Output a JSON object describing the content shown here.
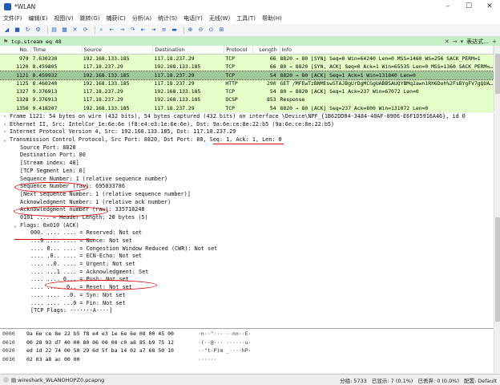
{
  "window": {
    "title": "*WLAN"
  },
  "menu": [
    "文件(F)",
    "编辑(E)",
    "视图(V)",
    "跳转(G)",
    "捕获(C)",
    "分析(A)",
    "统计(S)",
    "电话(Y)",
    "无线(W)",
    "工具(T)",
    "帮助(H)"
  ],
  "filter": {
    "value": "tcp.stream eq 48",
    "expression_label": "表达式…",
    "plus": "+"
  },
  "packet_list": {
    "columns": [
      "No.",
      "Time",
      "Source",
      "Destination",
      "Protocol",
      "Length",
      "Info"
    ],
    "rows": [
      {
        "no": "979",
        "time": "7.630230",
        "src": "192.168.133.185",
        "dst": "117.18.237.29",
        "proto": "TCP",
        "len": "66",
        "info": "8820 → 80 [SYN] Seq=0 Win=64240 Len=0 MSS=1460 WS=256 SACK_PERM=1"
      },
      {
        "no": "1120",
        "time": "8.459805",
        "src": "117.18.237.29",
        "dst": "192.168.133.185",
        "proto": "TCP",
        "len": "66",
        "info": "80 → 8820 [SYN, ACK] Seq=0 Ack=1 Win=65535 Len=0 MSS=1360 SACK_PERM=…"
      },
      {
        "no": "1121",
        "time": "8.459932",
        "src": "192.168.133.185",
        "dst": "117.18.237.29",
        "proto": "TCP",
        "len": "54",
        "info": "8820 → 80 [ACK] Seq=1 Ack=1 Win=131840 Len=0"
      },
      {
        "no": "1125",
        "time": "8.460240",
        "src": "192.168.133.185",
        "dst": "117.18.237.29",
        "proto": "HTTP",
        "len": "290",
        "info": "GET /MFEwTzBNMEswSTAJBgUrDgMCGgUABBSAUQYBMq2awn1Rh6Doh%2FsBYgFV7gQUA…"
      },
      {
        "no": "1327",
        "time": "9.376913",
        "src": "117.18.237.29",
        "dst": "192.168.133.185",
        "proto": "TCP",
        "len": "54",
        "info": "80 → 8820 [ACK] Seq=1 Ack=237 Win=67072 Len=0"
      },
      {
        "no": "1328",
        "time": "9.376913",
        "src": "117.18.237.29",
        "dst": "192.168.133.185",
        "proto": "OCSP",
        "len": "853",
        "info": "Response"
      },
      {
        "no": "1356",
        "time": "9.418207",
        "src": "192.168.133.185",
        "dst": "117.18.237.29",
        "proto": "TCP",
        "len": "54",
        "info": "8820 → 80 [ACK] Seq=237 Ack=800 Win=131072 Len=0"
      }
    ],
    "row_colors": [
      "#e4ffc7",
      "#e4ffc7",
      "#a0c89a",
      "#e4ffc7",
      "#e4ffc7",
      "#e4ffc7",
      "#e4ffc7"
    ],
    "selected_row_index": 2
  },
  "details": [
    {
      "indent": 0,
      "toggle": "›",
      "text": "Frame 1121: 54 bytes on wire (432 bits), 54 bytes captured (432 bits) on interface \\Device\\NPF_{1B62DD04-3484-40AF-8906-E6F1D5916A46}, id 0"
    },
    {
      "indent": 0,
      "toggle": "›",
      "text": "Ethernet II, Src: IntelCor_1e:6e:6e (f8:e4:e3:1e:6e:6e), Dst: 9a:6e:ce:8e:22:b5 (9a:6e:ce:8e:22:b5)"
    },
    {
      "indent": 0,
      "toggle": "›",
      "text": "Internet Protocol Version 4, Src: 192.168.133.185, Dst: 117.18.237.29"
    },
    {
      "indent": 0,
      "toggle": "⌄",
      "text": "Transmission Control Protocol, Src Port: 8820, Dst Port: 80, Seq: 1, Ack: 1, Len: 0"
    },
    {
      "indent": 1,
      "toggle": "",
      "text": "Source Port: 8820"
    },
    {
      "indent": 1,
      "toggle": "",
      "text": "Destination Port: 80"
    },
    {
      "indent": 1,
      "toggle": "",
      "text": "[Stream index: 48]"
    },
    {
      "indent": 1,
      "toggle": "",
      "text": "[TCP Segment Len: 0]"
    },
    {
      "indent": 1,
      "toggle": "",
      "text": "Sequence Number: 1    (relative sequence number)"
    },
    {
      "indent": 1,
      "toggle": "",
      "text": "Sequence Number (raw): 695033786"
    },
    {
      "indent": 1,
      "toggle": "",
      "text": "[Next Sequence Number: 1    (relative sequence number)]"
    },
    {
      "indent": 1,
      "toggle": "",
      "text": "Acknowledgment Number: 1    (relative ack number)"
    },
    {
      "indent": 1,
      "toggle": "",
      "text": "Acknowledgment number (raw): 335718248"
    },
    {
      "indent": 1,
      "toggle": "",
      "text": "0101 .... = Header Length: 20 bytes (5)"
    },
    {
      "indent": 1,
      "toggle": "⌄",
      "text": "Flags: 0x010 (ACK)"
    },
    {
      "indent": 2,
      "toggle": "",
      "text": "000. .... .... = Reserved: Not set"
    },
    {
      "indent": 2,
      "toggle": "",
      "text": "...0 .... .... = Nonce: Not set"
    },
    {
      "indent": 2,
      "toggle": "",
      "text": ".... 0... .... = Congestion Window Reduced (CWR): Not set"
    },
    {
      "indent": 2,
      "toggle": "",
      "text": ".... .0.. .... = ECN-Echo: Not set"
    },
    {
      "indent": 2,
      "toggle": "",
      "text": ".... ..0. .... = Urgent: Not set"
    },
    {
      "indent": 2,
      "toggle": "",
      "text": ".... ...1 .... = Acknowledgment: Set"
    },
    {
      "indent": 2,
      "toggle": "",
      "text": ".... .... 0... = Push: Not set"
    },
    {
      "indent": 2,
      "toggle": "",
      "text": ".... .... .0.. = Reset: Not set"
    },
    {
      "indent": 2,
      "toggle": "",
      "text": ".... .... ..0. = Syn: Not set"
    },
    {
      "indent": 2,
      "toggle": "",
      "text": ".... .... ...0 = Fin: Not set"
    },
    {
      "indent": 2,
      "toggle": "",
      "text": "[TCP Flags: ·······A····]"
    }
  ],
  "bytes": [
    {
      "off": "0000",
      "hex": "9a 6e ce 8e 22 b5 f8 e4  e3 1e 6e 6e 08 00 45 00",
      "asc": "·n··\"··· ··nn··E·"
    },
    {
      "off": "0010",
      "hex": "00 28 93 d7 40 00 80 06  00 00 c0 a8 85 b9 75 12",
      "asc": "·(··@··· ······u·"
    },
    {
      "off": "0020",
      "hex": "ed 1d 22 74 00 50 29 6d  5f ba 14 02 a7 68 50 10",
      "asc": "··\"t·P)m _····hP·"
    },
    {
      "off": "0030",
      "hex": "02 03 a8 ac 00 00",
      "asc": "······"
    }
  ],
  "status": {
    "file": "wireshark_WLANOHOPZ0.pcapng",
    "packets": "分组: 5733",
    "displayed": "已显示: 7 (0.1%)",
    "dropped": "已丢弃: 0 (0.0%)",
    "profile": "配置: Default"
  }
}
